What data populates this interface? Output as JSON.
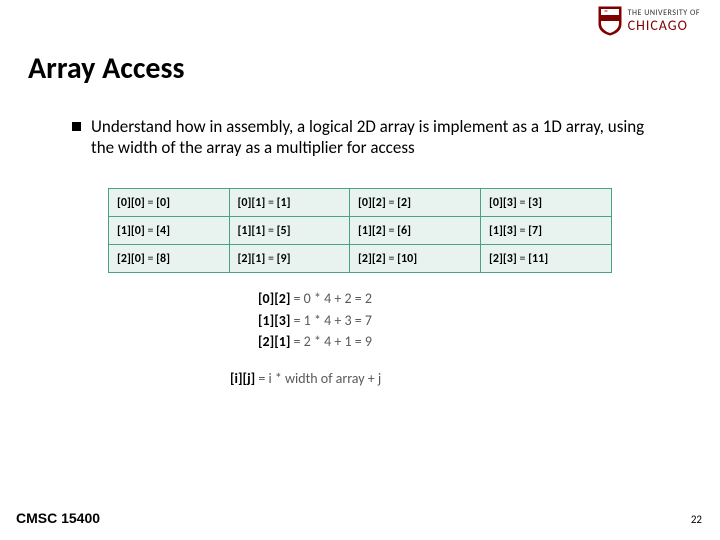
{
  "logo": {
    "line1": "THE UNIVERSITY OF",
    "line2": "CHICAGO"
  },
  "title": "Array Access",
  "bullet": "Understand how in assembly, a logical 2D array is implement as a 1D array, using the width of the array as a multiplier for access",
  "table": {
    "rows": [
      [
        {
          "idx2d": "[0][0]",
          "idx1d": "[0]"
        },
        {
          "idx2d": "[0][1]",
          "idx1d": "[1]"
        },
        {
          "idx2d": "[0][2]",
          "idx1d": "[2]"
        },
        {
          "idx2d": "[0][3]",
          "idx1d": "[3]"
        }
      ],
      [
        {
          "idx2d": "[1][0]",
          "idx1d": "[4]"
        },
        {
          "idx2d": "[1][1]",
          "idx1d": "[5]"
        },
        {
          "idx2d": "[1][2]",
          "idx1d": "[6]"
        },
        {
          "idx2d": "[1][3]",
          "idx1d": "[7]"
        }
      ],
      [
        {
          "idx2d": "[2][0]",
          "idx1d": "[8]"
        },
        {
          "idx2d": "[2][1]",
          "idx1d": "[9]"
        },
        {
          "idx2d": "[2][2]",
          "idx1d": "[10]"
        },
        {
          "idx2d": "[2][3]",
          "idx1d": "[11]"
        }
      ]
    ]
  },
  "formulas": [
    {
      "lhs": "[0][2]",
      "rhs": " = 0 * 4 + 2 = 2"
    },
    {
      "lhs": "[1][3]",
      "rhs": " = 1 * 4 + 3 = 7"
    },
    {
      "lhs": "[2][1]",
      "rhs": " = 2 * 4 + 1 = 9"
    }
  ],
  "general_formula": {
    "lhs": "[i][j]",
    "rhs": " = i * width of array + j"
  },
  "footer": {
    "left": "CMSC 15400",
    "right": "22"
  }
}
